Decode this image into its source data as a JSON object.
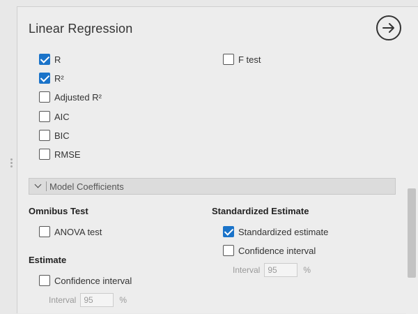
{
  "panel": {
    "title": "Linear Regression",
    "run_icon": "arrow-right-circle-icon"
  },
  "fit_measures": {
    "items": [
      {
        "label": "R",
        "checked": true
      },
      {
        "label": "R²",
        "checked": true
      },
      {
        "label": "Adjusted R²",
        "checked": false
      },
      {
        "label": "AIC",
        "checked": false
      },
      {
        "label": "BIC",
        "checked": false
      },
      {
        "label": "RMSE",
        "checked": false
      }
    ],
    "ftest": {
      "label": "F test",
      "checked": false
    }
  },
  "model_coefficients": {
    "section_label": "Model Coefficients",
    "omnibus_heading": "Omnibus Test",
    "anova": {
      "label": "ANOVA test",
      "checked": false
    },
    "estimate_heading": "Estimate",
    "estimate_ci": {
      "label": "Confidence interval",
      "checked": false
    },
    "estimate_interval": {
      "label": "Interval",
      "value": "95",
      "unit": "%"
    },
    "std_heading": "Standardized Estimate",
    "std_estimate": {
      "label": "Standardized estimate",
      "checked": true
    },
    "std_ci": {
      "label": "Confidence interval",
      "checked": false
    },
    "std_interval": {
      "label": "Interval",
      "value": "95",
      "unit": "%"
    }
  },
  "colors": {
    "accent": "#1a73c9"
  }
}
